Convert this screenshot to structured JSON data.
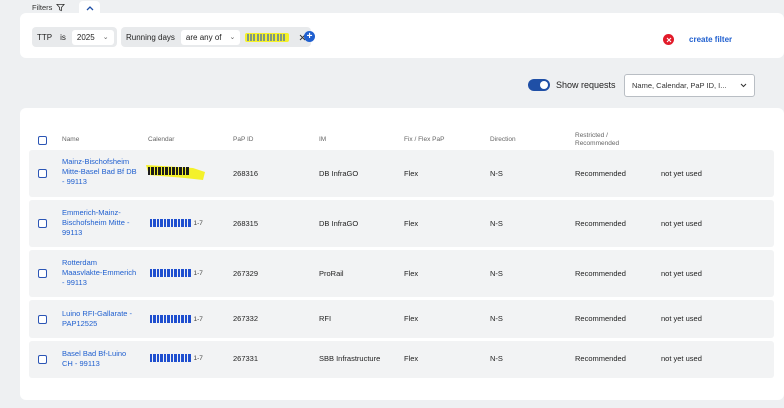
{
  "filters": {
    "label": "Filters",
    "ttp": {
      "label": "TTP",
      "op": "is",
      "value": "2025"
    },
    "running_days": {
      "label": "Running days",
      "op": "are any of"
    },
    "create_filter": "create filter"
  },
  "toolbar": {
    "show_requests_label": "Show requests",
    "show_requests_on": true,
    "search_value": "Name, Calendar, PaP ID, I..."
  },
  "table": {
    "headers": {
      "name": "Name",
      "calendar": "Calendar",
      "pap_id": "PaP ID",
      "im": "IM",
      "fix_flex": "Fix / Flex PaP",
      "direction": "Direction",
      "restricted_line1": "Restricted /",
      "restricted_line2": "Recommended"
    },
    "rows": [
      {
        "name": [
          "Mainz-Bischofsheim",
          "Mitte-Basel Bad Bf DB",
          "- 99113"
        ],
        "calendar_range": "",
        "pap_id": "268316",
        "im": "DB InfraGO",
        "fix_flex": "Flex",
        "direction": "N-S",
        "restricted": "Recommended",
        "status": "not yet used"
      },
      {
        "name": [
          "Emmerich-Mainz-",
          "Bischofsheim Mitte -",
          "99113"
        ],
        "calendar_range": "1-7",
        "pap_id": "268315",
        "im": "DB InfraGO",
        "fix_flex": "Flex",
        "direction": "N-S",
        "restricted": "Recommended",
        "status": "not yet used"
      },
      {
        "name": [
          "Rotterdam",
          "Maasvlakte-Emmerich",
          "- 99113"
        ],
        "calendar_range": "1-7",
        "pap_id": "267329",
        "im": "ProRail",
        "fix_flex": "Flex",
        "direction": "N-S",
        "restricted": "Recommended",
        "status": "not yet used"
      },
      {
        "name": [
          "Luino RFI-Gallarate -",
          "PAP12525"
        ],
        "calendar_range": "1-7",
        "pap_id": "267332",
        "im": "RFI",
        "fix_flex": "Flex",
        "direction": "N-S",
        "restricted": "Recommended",
        "status": "not yet used"
      },
      {
        "name": [
          "Basel Bad Bf-Luino",
          "CH - 99113"
        ],
        "calendar_range": "1-7",
        "pap_id": "267331",
        "im": "SBB Infrastructure",
        "fix_flex": "Flex",
        "direction": "N-S",
        "restricted": "Recommended",
        "status": "not yet used"
      }
    ]
  },
  "colors": {
    "accent": "#1f5fcf",
    "highlight": "#f4f12a",
    "danger": "#e21b2a"
  }
}
